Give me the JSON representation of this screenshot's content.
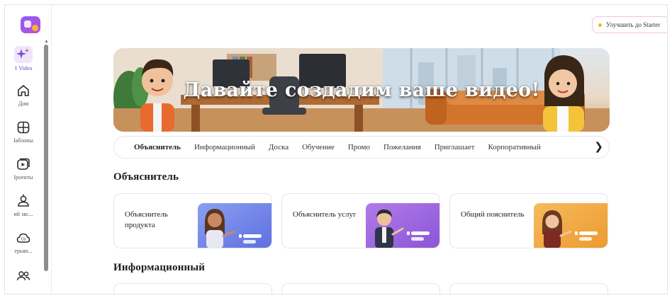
{
  "sidebar": {
    "items": [
      {
        "label": "1 Video",
        "icon": "sparkle-icon"
      },
      {
        "label": "Дом",
        "icon": "home-icon"
      },
      {
        "label": "Iаблоны",
        "icon": "templates-icon"
      },
      {
        "label": "Iроекты",
        "icon": "projects-icon"
      },
      {
        "label": "ий экс...",
        "icon": "avatar-icon"
      },
      {
        "label": "ерьян...",
        "icon": "cloud-icon"
      },
      {
        "label": "",
        "icon": "team-icon"
      }
    ]
  },
  "header": {
    "upgrade_label": "Улучшить до Starter"
  },
  "banner": {
    "title": "Давайте создадим ваше видео!"
  },
  "tabs": [
    {
      "label": "Объяснитель",
      "active": true
    },
    {
      "label": "Информационный"
    },
    {
      "label": "Доска"
    },
    {
      "label": "Обучение"
    },
    {
      "label": "Промо"
    },
    {
      "label": "Пожелания"
    },
    {
      "label": "Приглашает"
    },
    {
      "label": "Корпоративный"
    }
  ],
  "sections": [
    {
      "title": "Объяснитель",
      "cards": [
        {
          "label": "Объяснитель продукта",
          "thumb_color": "#6f7fe8"
        },
        {
          "label": "Объяснитель услуг",
          "thumb_color": "#9a63e0"
        },
        {
          "label": "Общий пояснитель",
          "thumb_color": "#f0a23c"
        }
      ]
    },
    {
      "title": "Информационный"
    }
  ],
  "colors": {
    "accent": "#6b3fd4",
    "upgrade_border": "#f0c6d8",
    "upgrade_dot": "#f6b61e"
  }
}
